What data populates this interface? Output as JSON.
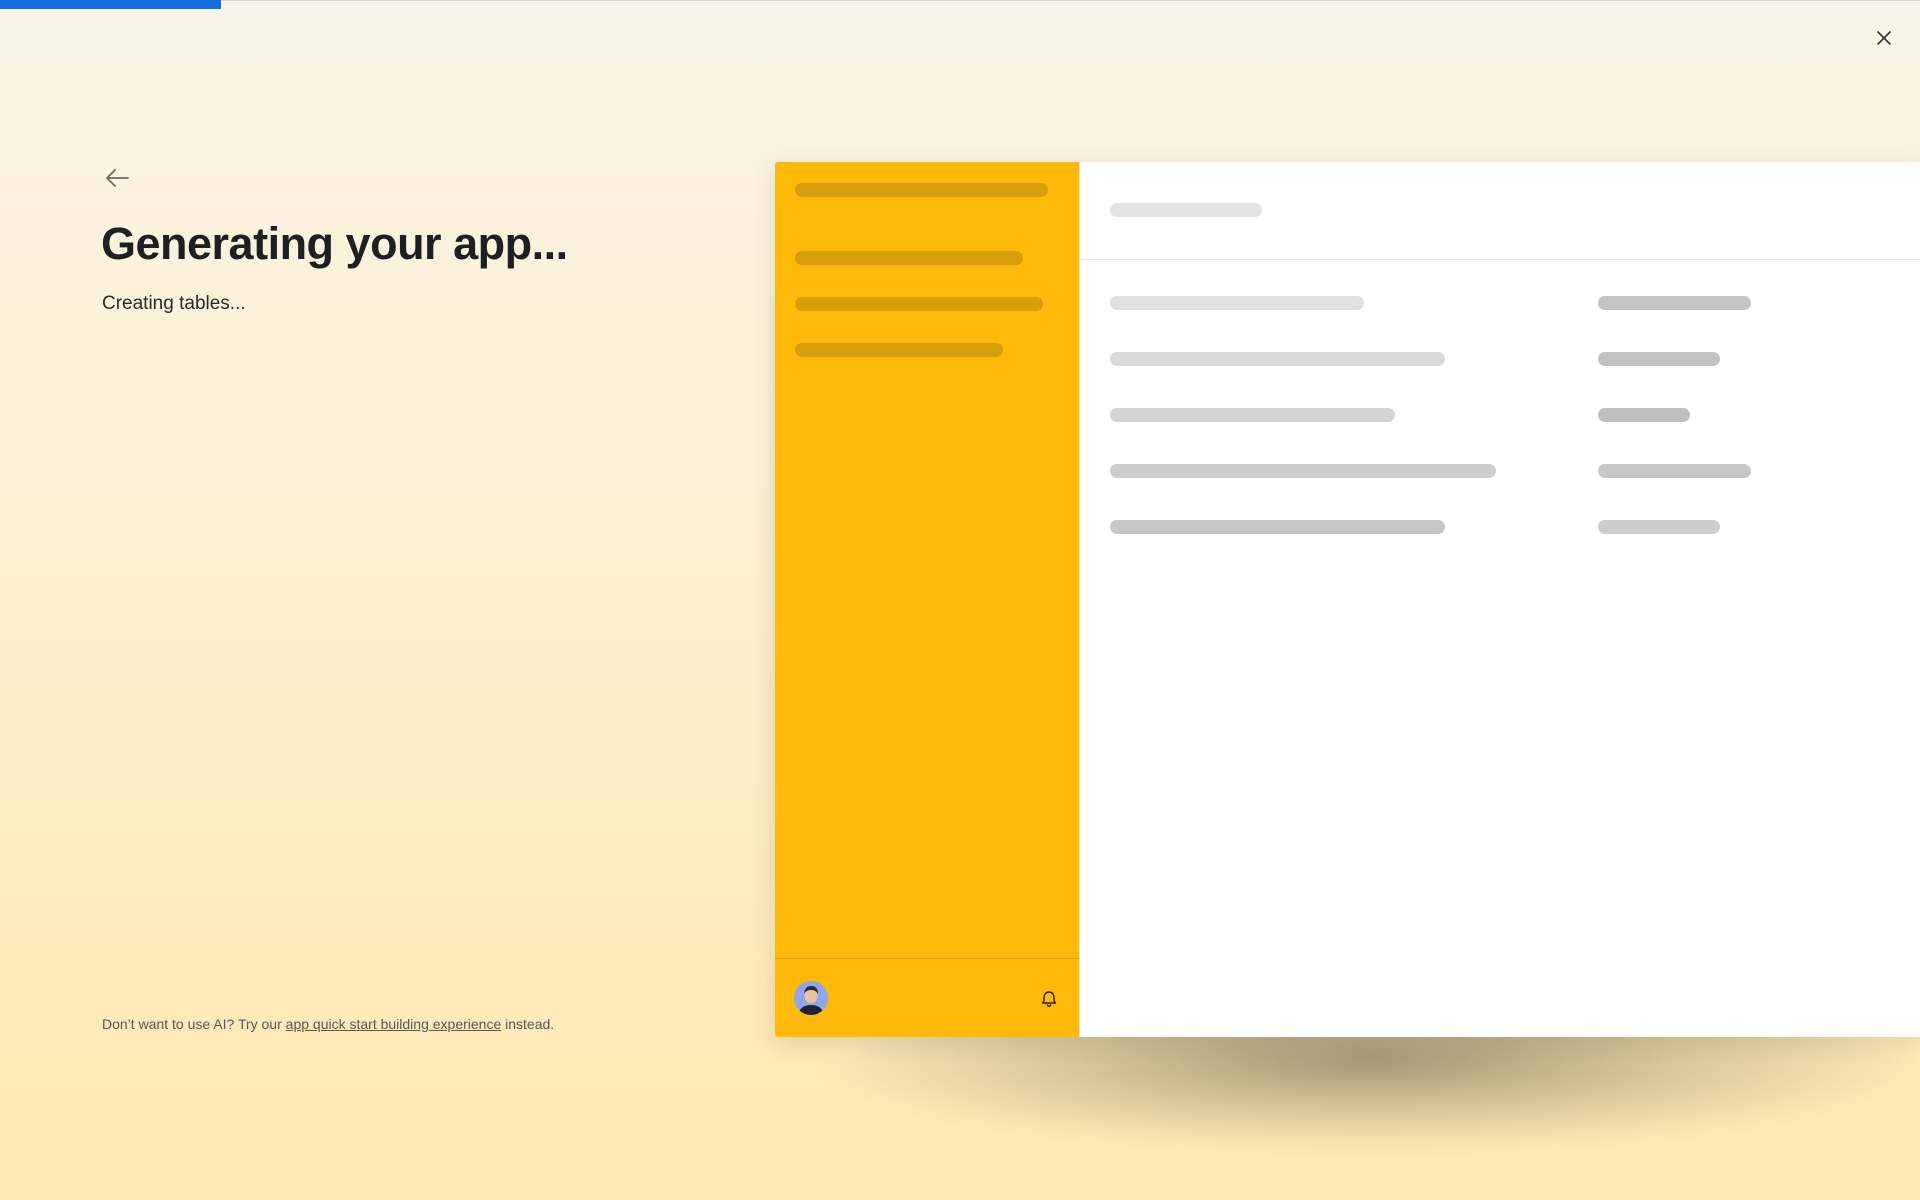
{
  "progress": {
    "fraction": 0.115
  },
  "header": {
    "close_icon": "close-icon",
    "back_icon": "arrow-left-icon"
  },
  "main": {
    "title": "Generating your app...",
    "status": "Creating tables..."
  },
  "footer": {
    "prefix": "Don’t want to use AI? Try our",
    "link_text": "app quick start building experience",
    "suffix": "instead."
  },
  "colors": {
    "accent": "#166ee1",
    "sidebar": "#ffb90a",
    "sidebar_skeleton": "#d79e0c",
    "skeleton_light": "#e0e0e0",
    "skeleton_mid": "#cfcfcf",
    "skeleton_dark": "#bdbdbd"
  },
  "preview": {
    "avatar_icon": "user-avatar",
    "bell_icon": "bell-icon"
  }
}
